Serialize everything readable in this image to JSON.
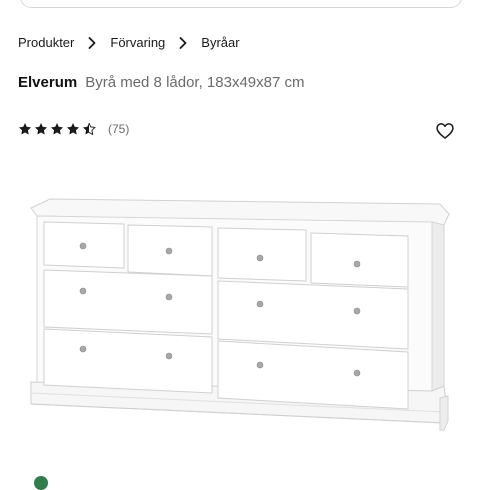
{
  "breadcrumb": {
    "items": [
      "Produkter",
      "Förvaring",
      "Byråar"
    ]
  },
  "product": {
    "name": "Elverum",
    "description": "Byrå med 8 lådor, 183x49x87 cm",
    "rating": 4.5,
    "review_count": "(75)"
  },
  "icons": {
    "separator": "chevron-right-icon",
    "favorite": "heart-outline-icon",
    "star": "star-icon"
  },
  "colors": {
    "text": "#1a1a1a",
    "muted": "#6b6b6b",
    "product_white": "#ffffff"
  }
}
